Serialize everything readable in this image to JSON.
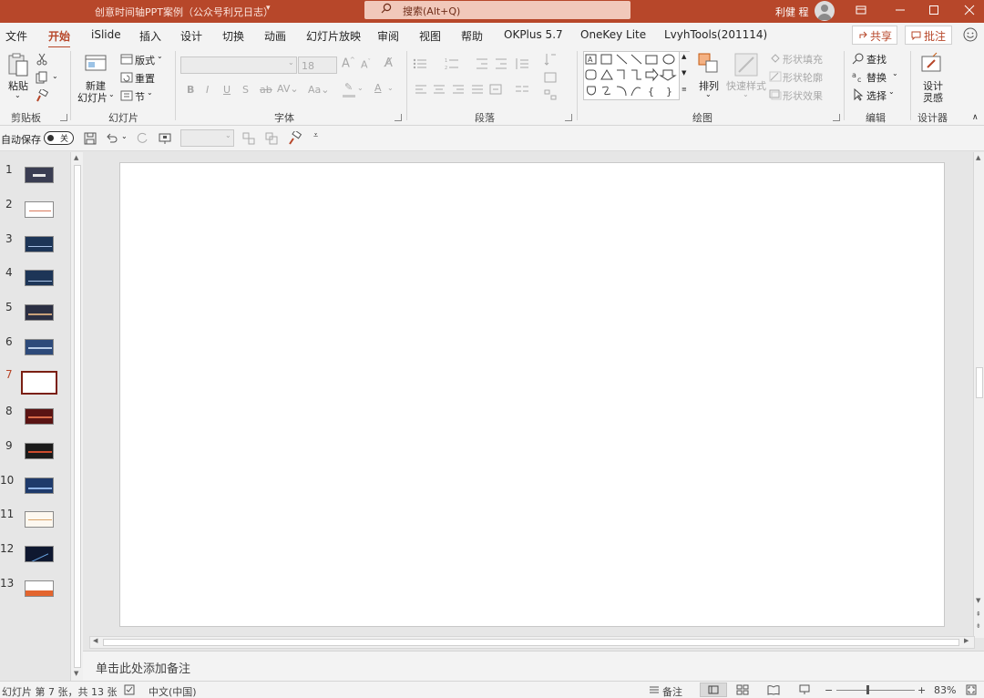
{
  "window": {
    "doc_title": "创意时间轴PPT案例（公众号利兄日志）",
    "search_placeholder": "搜索(Alt+Q)",
    "user_name": "利健 程"
  },
  "menu": {
    "tabs": [
      "文件",
      "开始",
      "iSlide",
      "插入",
      "设计",
      "切换",
      "动画",
      "幻灯片放映",
      "审阅",
      "视图",
      "帮助",
      "OKPlus 5.7",
      "OneKey Lite",
      "LvyhTools(201114)"
    ],
    "active_tab": "开始",
    "share_label": "共享",
    "comment_label": "批注"
  },
  "ribbon": {
    "clipboard": {
      "paste": "粘贴",
      "group": "剪贴板"
    },
    "slides": {
      "new_slide_line1": "新建",
      "new_slide_line2": "幻灯片",
      "layout": "版式",
      "reset": "重置",
      "section": "节",
      "group": "幻灯片"
    },
    "font": {
      "size": "18",
      "group": "字体"
    },
    "paragraph": {
      "group": "段落"
    },
    "drawing": {
      "arrange": "排列",
      "quick_styles": "快速样式",
      "shape_fill": "形状填充",
      "shape_outline": "形状轮廓",
      "shape_effects": "形状效果",
      "group": "绘图"
    },
    "editing": {
      "find": "查找",
      "replace": "替换",
      "select": "选择",
      "group": "编辑"
    },
    "designer": {
      "line1": "设计",
      "line2": "灵感",
      "group": "设计器"
    }
  },
  "qat": {
    "autosave_label": "自动保存",
    "toggle_state": "关"
  },
  "slides": {
    "numbers": [
      "1",
      "2",
      "3",
      "4",
      "5",
      "6",
      "7",
      "8",
      "9",
      "10",
      "11",
      "12",
      "13"
    ],
    "active_index": 7
  },
  "notes": {
    "placeholder": "单击此处添加备注"
  },
  "status": {
    "slide_info": "幻灯片 第 7 张，共 13 张",
    "language": "中文(中国)",
    "notes_label": "备注",
    "zoom": "83%"
  },
  "colors": {
    "accent": "#b7472a",
    "title_bar": "#b7472a"
  }
}
